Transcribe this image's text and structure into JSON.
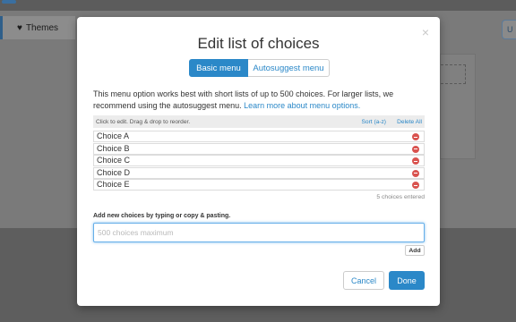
{
  "background": {
    "themes_label": "Themes",
    "right_button_label": "U"
  },
  "modal": {
    "title": "Edit list of choices",
    "close_glyph": "×",
    "tabs": [
      {
        "label": "Basic menu",
        "active": true
      },
      {
        "label": "Autosuggest menu",
        "active": false
      }
    ],
    "description": "This menu option works best with short lists of up to 500 choices. For larger lists, we recommend using the autosuggest menu.",
    "learn_more_link": "Learn more about menu options.",
    "list_header": {
      "hint": "Click to edit. Drag & drop to reorder.",
      "sort_label": "Sort (a-z)",
      "delete_all_label": "Delete All"
    },
    "choices": [
      "Choice A",
      "Choice B",
      "Choice C",
      "Choice D",
      "Choice E"
    ],
    "choices_count_text": "5 choices entered",
    "add_section": {
      "label": "Add new choices by typing or copy & pasting.",
      "placeholder": "500 choices maximum",
      "value": "",
      "add_button": "Add"
    },
    "footer": {
      "cancel_label": "Cancel",
      "done_label": "Done"
    }
  },
  "colors": {
    "accent": "#2b88c8",
    "remove": "#d9534f",
    "overlay": "#6e6e6e"
  }
}
